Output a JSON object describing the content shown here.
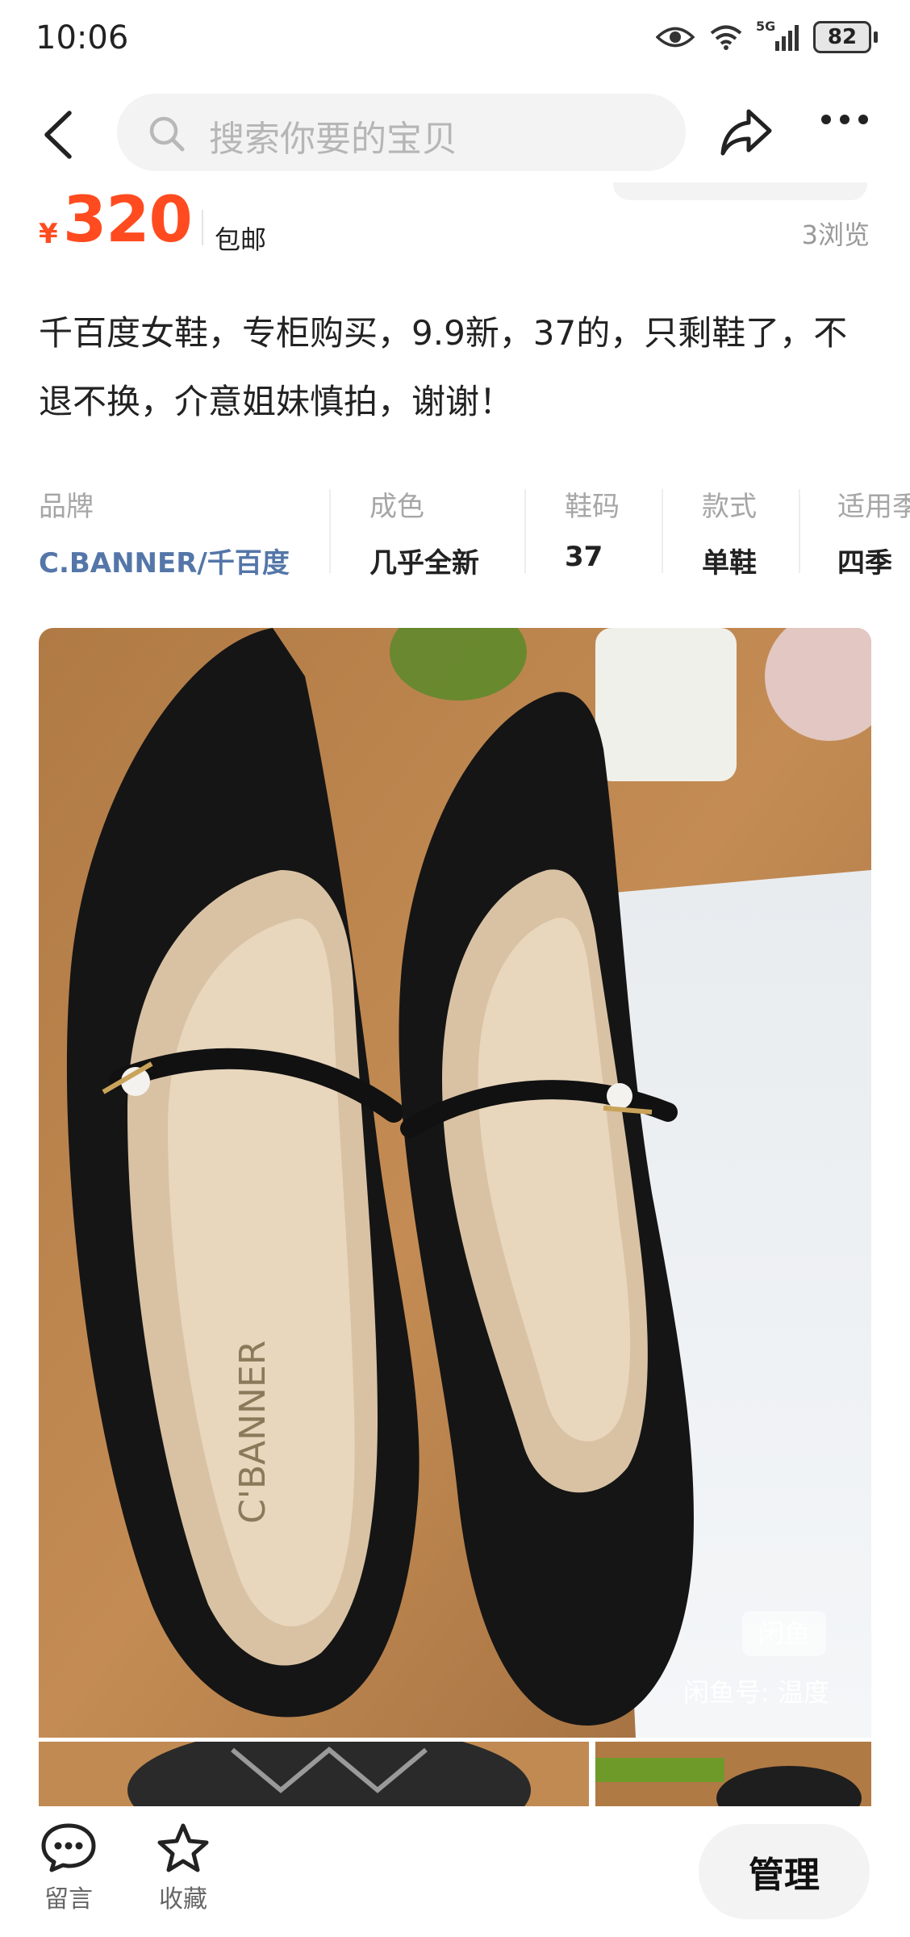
{
  "status_bar": {
    "time": "10:06",
    "network": "5G",
    "battery": "82"
  },
  "nav": {
    "search_placeholder": "搜索你要的宝贝"
  },
  "listing": {
    "currency": "¥",
    "price": "320",
    "shipping": "包邮",
    "views": "3浏览",
    "description": "千百度女鞋，专柜购买，9.9新，37的，只剩鞋了，不退不换，介意姐妹慎拍，谢谢！"
  },
  "attributes": [
    {
      "label": "品牌",
      "value": "C.BANNER/千百度"
    },
    {
      "label": "成色",
      "value": "几乎全新"
    },
    {
      "label": "鞋码",
      "value": "37"
    },
    {
      "label": "款式",
      "value": "单鞋"
    },
    {
      "label": "适用季",
      "value": "四季"
    }
  ],
  "photo": {
    "insole_brand": "C'BANNER",
    "watermark_logo": "闲鱼",
    "watermark_text": "闲鱼号: 温度"
  },
  "bottom_bar": {
    "comment_label": "留言",
    "favorite_label": "收藏",
    "manage_label": "管理"
  },
  "colors": {
    "price": "#ff4b1f",
    "brand_link": "#5476a8",
    "muted": "#a6a6a6"
  }
}
